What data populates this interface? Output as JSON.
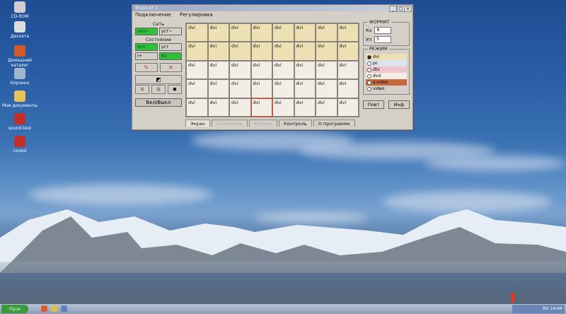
{
  "desktop_icons": [
    {
      "label": "CD-ROM",
      "color": "#cfcfcf"
    },
    {
      "label": "Дискета",
      "color": "#dddddd"
    },
    {
      "label": "Домашний каталог",
      "color": "#d25a2a"
    },
    {
      "label": "Корзина",
      "color": "#9fb8c9"
    },
    {
      "label": "Мои документы",
      "color": "#e4c35a"
    },
    {
      "label": "sound-test",
      "color": "#c0302a"
    },
    {
      "label": "consol",
      "color": "#c0302a"
    }
  ],
  "window": {
    "title": "Форм.вт 2",
    "menu": [
      "Подключение",
      "Регулировка"
    ],
    "left": {
      "net_label": "Сеть",
      "net_buttons": [
        "осп~",
        "уст~"
      ],
      "state_label": "Состояние",
      "state_row1": [
        "осп",
        "уст"
      ],
      "state_row2": [
        "I+",
        "Itv"
      ],
      "power_label": "Вкл/Выкл"
    },
    "grid_label": "dvi",
    "tabs": [
      "Экран",
      "Геометрия",
      "Модули",
      "Контроль",
      "О программе"
    ],
    "active_tab": 0,
    "format": {
      "legend": "ФОРМАТ",
      "kh_label": "Кх",
      "kh_value": "8",
      "yn_label": "Уп",
      "yn_value": "5"
    },
    "mode": {
      "legend": "РЕЖИМ",
      "options": [
        {
          "label": "dvi",
          "color": "#ece0b4",
          "checked": true
        },
        {
          "label": "pc",
          "color": "#d9e4ee",
          "checked": false
        },
        {
          "label": "dtv",
          "color": "#f0c4cc",
          "checked": false
        },
        {
          "label": "dvd",
          "color": "#f2eee6",
          "checked": false
        },
        {
          "label": "s-video",
          "color": "#c66a42",
          "checked": false
        },
        {
          "label": "video",
          "color": "#d4d0c8",
          "checked": false
        }
      ]
    },
    "buttons": {
      "repeat": "Повт",
      "info": "Инф"
    }
  },
  "taskbar": {
    "start_label": "Пуск",
    "tray_text": "RU  14:44"
  }
}
